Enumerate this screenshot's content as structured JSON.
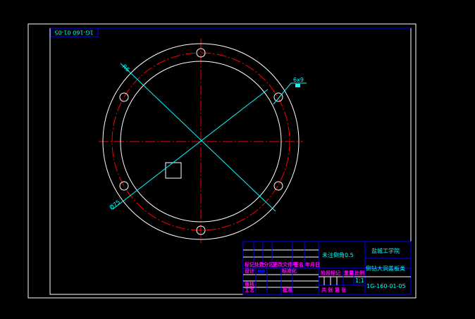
{
  "drawing": {
    "drawing_number": "1G-160-01-05",
    "drawing_number_mirrored": "1G-160 01-05",
    "hole_callout": "6x9",
    "dim_left_top": "R6",
    "dim_left_bottom": "Ø75"
  },
  "title_block": {
    "school": "盐城工学院",
    "part_name": "倒钻大洞盖板类",
    "note": "未注倒角0.5",
    "row_labels": [
      "标记",
      "处数",
      "分区",
      "更改文件号",
      "签名",
      "年月日"
    ],
    "design": "设计",
    "standardization": "标准化",
    "review": "审核",
    "process": "工艺",
    "approve": "批准",
    "stage_mark": "阶段标记",
    "weight": "重量",
    "scale": "比例",
    "scale_value": "1:1",
    "sheets": "共  张 第  张"
  },
  "colors": {
    "frame": "#ffffff",
    "title_block": "#0000ff",
    "center_lines": "#ff0000",
    "dimensions": "#00ffff",
    "labels": "#ff00ff"
  }
}
